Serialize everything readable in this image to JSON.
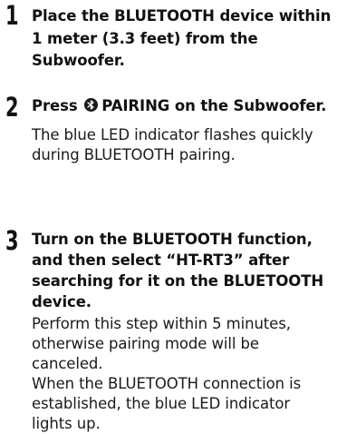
{
  "steps": [
    {
      "number": "1",
      "instruction": "Place the BLUETOOTH device within 1 meter (3.3 feet) from the Subwoofer."
    },
    {
      "number": "2",
      "instruction_prefix": "Press",
      "instruction_icon": "bluetooth-icon",
      "instruction_suffix": "PAIRING on the Subwoofer.",
      "notes": [
        "The blue LED indicator flashes quickly during BLUETOOTH pairing."
      ]
    },
    {
      "number": "3",
      "instruction": "Turn on the BLUETOOTH function, and then select “HT-RT3” after searching for it on the BLUETOOTH device.",
      "notes": [
        "Perform this step within 5 minutes, otherwise pairing mode will be canceled.",
        "When the BLUETOOTH connection is established, the blue LED indicator lights up."
      ]
    }
  ]
}
